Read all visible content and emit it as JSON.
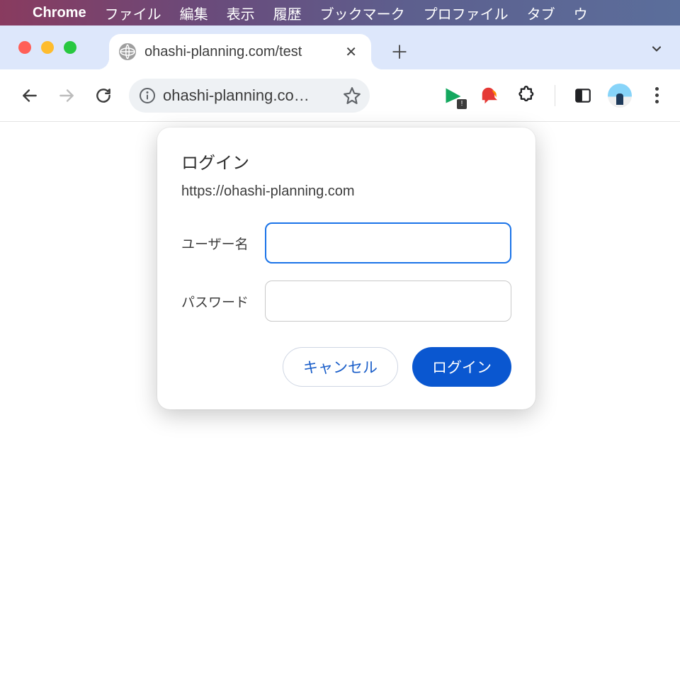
{
  "macmenu": {
    "app": "Chrome",
    "items": [
      "ファイル",
      "編集",
      "表示",
      "履歴",
      "ブックマーク",
      "プロファイル",
      "タブ",
      "ウ"
    ]
  },
  "window_controls": {
    "close": "close",
    "min": "minimize",
    "max": "maximize"
  },
  "tab": {
    "title": "ohashi-planning.com/test"
  },
  "toolbar": {
    "url_display": "ohashi-planning.co…"
  },
  "dialog": {
    "title": "ログイン",
    "origin": "https://ohashi-planning.com",
    "username_label": "ユーザー名",
    "password_label": "パスワード",
    "username_value": "",
    "password_value": "",
    "cancel": "キャンセル",
    "submit": "ログイン"
  }
}
